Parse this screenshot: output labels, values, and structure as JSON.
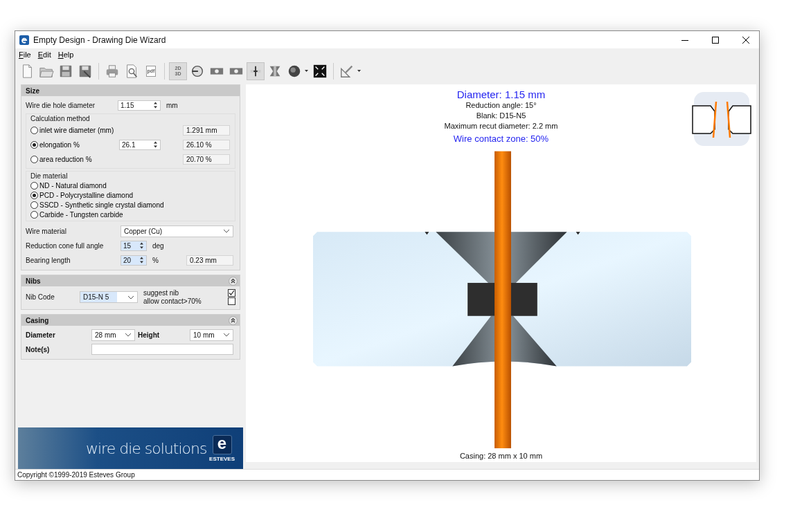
{
  "window": {
    "title": "Empty Design - Drawing Die Wizard"
  },
  "menu": [
    {
      "label": "File"
    },
    {
      "label": "Edit"
    },
    {
      "label": "Help"
    }
  ],
  "toolbar": [
    {
      "kind": "new",
      "pressed": false,
      "dropdown": false
    },
    {
      "kind": "open",
      "pressed": false,
      "dropdown": false
    },
    {
      "kind": "save",
      "pressed": false,
      "dropdown": false
    },
    {
      "kind": "save-as",
      "pressed": false,
      "dropdown": false
    },
    {
      "kind": "separator"
    },
    {
      "kind": "print",
      "pressed": false,
      "dropdown": false
    },
    {
      "kind": "preview",
      "pressed": false,
      "dropdown": false
    },
    {
      "kind": "pdf",
      "label": "pdf",
      "pressed": false,
      "dropdown": false
    },
    {
      "kind": "separator"
    },
    {
      "kind": "view",
      "label": "2D 3D",
      "pressed": true,
      "dropdown": false
    },
    {
      "kind": "rotate",
      "pressed": false,
      "dropdown": false
    },
    {
      "kind": "section",
      "pressed": false,
      "dropdown": false
    },
    {
      "kind": "section",
      "pressed": false,
      "dropdown": false
    },
    {
      "kind": "center",
      "pressed": true,
      "dropdown": false
    },
    {
      "kind": "cone",
      "pressed": false,
      "dropdown": false
    },
    {
      "kind": "shade",
      "pressed": false,
      "dropdown": true
    },
    {
      "kind": "fit",
      "pressed": false,
      "dropdown": false
    },
    {
      "kind": "separator"
    },
    {
      "kind": "measure",
      "pressed": false,
      "dropdown": true
    }
  ],
  "size": {
    "title": "Size",
    "hole_diameter": {
      "label": "Wire die hole diameter",
      "value": "1.15",
      "unit": "mm"
    },
    "calculation": {
      "title": "Calculation method",
      "options": [
        {
          "label": "inlet wire diameter (mm)",
          "selected": false,
          "result": "1.291 mm"
        },
        {
          "label": "elongation %",
          "selected": true,
          "input": "26.1",
          "result": "26.10 %"
        },
        {
          "label": "area reduction %",
          "selected": false,
          "result": "20.70 %"
        }
      ]
    },
    "die_material": {
      "title": "Die material",
      "options": [
        {
          "label": "ND - Natural diamond",
          "selected": false
        },
        {
          "label": "PCD - Polycrystalline diamond",
          "selected": true
        },
        {
          "label": "SSCD - Synthetic single crystal diamond",
          "selected": false
        },
        {
          "label": "Carbide - Tungsten carbide",
          "selected": false
        }
      ]
    },
    "wire_material": {
      "label": "Wire material",
      "value": "Copper (Cu)"
    },
    "cone_angle": {
      "label": "Reduction cone full angle",
      "value": "15",
      "unit": "deg"
    },
    "bearing_length": {
      "label": "Bearing length",
      "value": "20",
      "unit": "%",
      "result": "0.23 mm"
    }
  },
  "nibs": {
    "title": "Nibs",
    "nib_code": {
      "label": "Nib Code",
      "value": "D15-N 5"
    },
    "options": [
      {
        "label": "suggest nib",
        "checked": true
      },
      {
        "label": "allow contact>70%",
        "checked": false
      }
    ]
  },
  "casing": {
    "title": "Casing",
    "diameter": {
      "label": "Diameter",
      "value": "28 mm"
    },
    "height": {
      "label": "Height",
      "value": "10 mm"
    },
    "notes": {
      "label": "Note(s)"
    }
  },
  "banner": {
    "slogan": "wire die solutions",
    "logo_letter": "e",
    "brand": "ESTEVES"
  },
  "view": {
    "title": "Diameter: 1.15 mm",
    "details": [
      "Reduction angle: 15°",
      "Blank: D15-N5",
      "Maximum recut diameter: 2.2 mm"
    ],
    "contact_zone": "Wire contact zone: 50%",
    "casing": "Casing: 28 mm x 10 mm"
  },
  "status_bar": {
    "text": "Copyright ©1999-2019 Esteves Group"
  }
}
